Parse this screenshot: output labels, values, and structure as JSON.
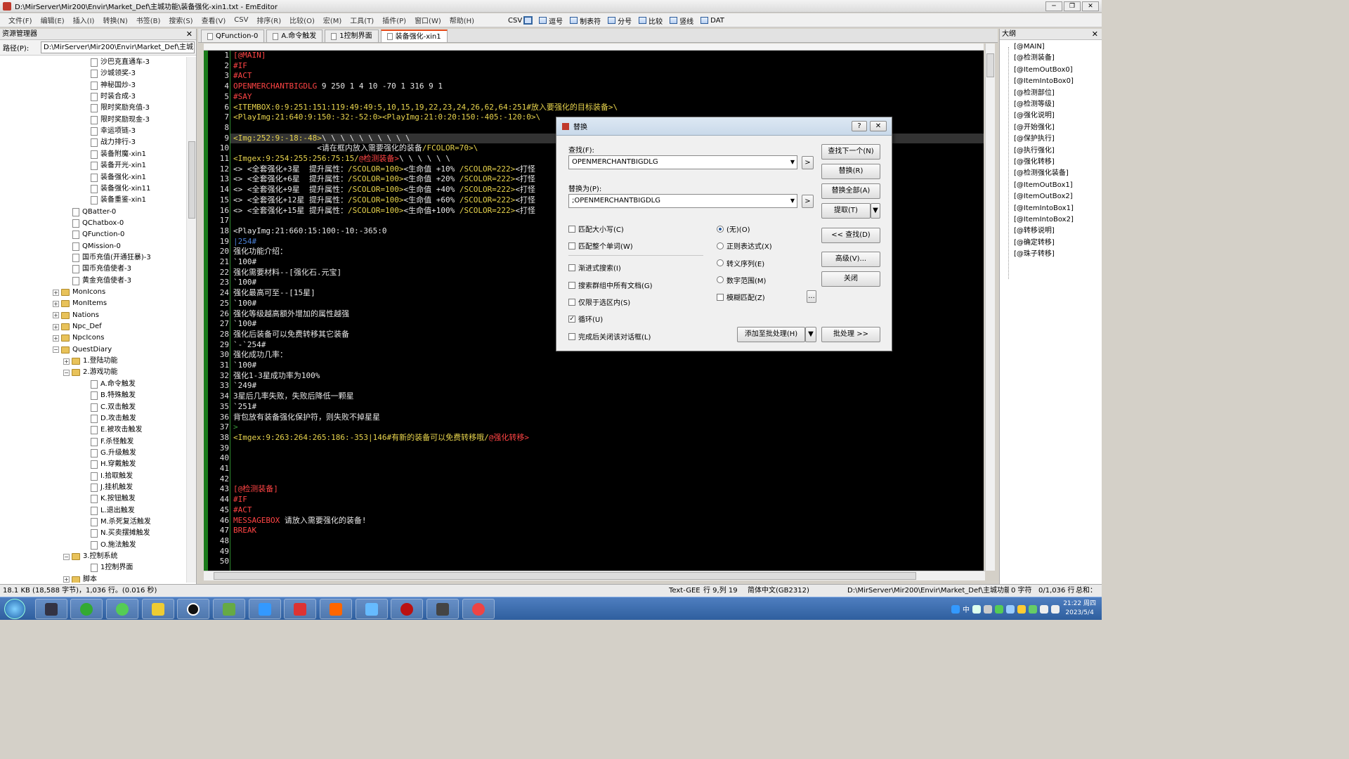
{
  "window": {
    "title": "D:\\MirServer\\Mir200\\Envir\\Market_Def\\主城功能\\装备强化-xin1.txt - EmEditor",
    "min": "─",
    "max": "❐",
    "close": "✕"
  },
  "menu": [
    "文件(F)",
    "编辑(E)",
    "插入(I)",
    "转换(N)",
    "书签(B)",
    "搜索(S)",
    "查看(V)",
    "CSV",
    "排序(R)",
    "比较(O)",
    "宏(M)",
    "工具(T)",
    "插件(P)",
    "窗口(W)",
    "帮助(H)"
  ],
  "toolbar": {
    "csv": "CSV",
    "items": [
      "逗号",
      "制表符",
      "分号",
      "比较",
      "竖线",
      "DAT"
    ]
  },
  "explorer": {
    "title": "资源管理器",
    "close": "✕",
    "path_label": "路径(P):",
    "path": "D:\\MirServer\\Mir200\\Envir\\Market_Def\\主城"
  },
  "tree": [
    {
      "l": "沙巴克直通车-3",
      "d": 3,
      "t": "doc"
    },
    {
      "l": "沙城领奖-3",
      "d": 3,
      "t": "doc"
    },
    {
      "l": "神秘国炒-3",
      "d": 3,
      "t": "doc"
    },
    {
      "l": "时装合成-3",
      "d": 3,
      "t": "doc"
    },
    {
      "l": "限时奖励充值-3",
      "d": 3,
      "t": "doc"
    },
    {
      "l": "限时奖励现金-3",
      "d": 3,
      "t": "doc"
    },
    {
      "l": "幸运项链-3",
      "d": 3,
      "t": "doc"
    },
    {
      "l": "战力排行-3",
      "d": 3,
      "t": "doc"
    },
    {
      "l": "装备附魔-xin1",
      "d": 3,
      "t": "doc"
    },
    {
      "l": "装备开光-xin1",
      "d": 3,
      "t": "doc"
    },
    {
      "l": "装备强化-xin1",
      "d": 3,
      "t": "doc"
    },
    {
      "l": "装备强化-xin11",
      "d": 3,
      "t": "doc"
    },
    {
      "l": "装备重鉴-xin1",
      "d": 3,
      "t": "doc"
    },
    {
      "l": "QBatter-0",
      "d": 2,
      "t": "doc"
    },
    {
      "l": "QChatbox-0",
      "d": 2,
      "t": "doc"
    },
    {
      "l": "QFunction-0",
      "d": 2,
      "t": "doc"
    },
    {
      "l": "QMission-0",
      "d": 2,
      "t": "doc"
    },
    {
      "l": "国币充值(开通狂暴)-3",
      "d": 2,
      "t": "doc"
    },
    {
      "l": "国币充值使者-3",
      "d": 2,
      "t": "doc"
    },
    {
      "l": "黄金充值使者-3",
      "d": 2,
      "t": "doc"
    },
    {
      "l": "MonIcons",
      "d": 1,
      "t": "fold",
      "e": "+"
    },
    {
      "l": "MonItems",
      "d": 1,
      "t": "fold",
      "e": "+"
    },
    {
      "l": "Nations",
      "d": 1,
      "t": "fold",
      "e": "+"
    },
    {
      "l": "Npc_Def",
      "d": 1,
      "t": "fold",
      "e": "+"
    },
    {
      "l": "NpcIcons",
      "d": 1,
      "t": "fold",
      "e": "+"
    },
    {
      "l": "QuestDiary",
      "d": 1,
      "t": "fold",
      "e": "−"
    },
    {
      "l": "1.登陆功能",
      "d": 2,
      "t": "fold",
      "e": "+"
    },
    {
      "l": "2.游戏功能",
      "d": 2,
      "t": "fold",
      "e": "−"
    },
    {
      "l": "A.命令触发",
      "d": 3,
      "t": "doc"
    },
    {
      "l": "B.特殊触发",
      "d": 3,
      "t": "doc"
    },
    {
      "l": "C.双击触发",
      "d": 3,
      "t": "doc"
    },
    {
      "l": "D.攻击触发",
      "d": 3,
      "t": "doc"
    },
    {
      "l": "E.被攻击触发",
      "d": 3,
      "t": "doc"
    },
    {
      "l": "F.杀怪触发",
      "d": 3,
      "t": "doc"
    },
    {
      "l": "G.升级触发",
      "d": 3,
      "t": "doc"
    },
    {
      "l": "H.穿戴触发",
      "d": 3,
      "t": "doc"
    },
    {
      "l": "I.拾取触发",
      "d": 3,
      "t": "doc"
    },
    {
      "l": "J.挂机触发",
      "d": 3,
      "t": "doc"
    },
    {
      "l": "K.按钮触发",
      "d": 3,
      "t": "doc"
    },
    {
      "l": "L.退出触发",
      "d": 3,
      "t": "doc"
    },
    {
      "l": "M.杀死复活触发",
      "d": 3,
      "t": "doc"
    },
    {
      "l": "N.买卖摆摊触发",
      "d": 3,
      "t": "doc"
    },
    {
      "l": "O.施法触发",
      "d": 3,
      "t": "doc"
    },
    {
      "l": "3.控制系统",
      "d": 2,
      "t": "fold",
      "e": "−"
    },
    {
      "l": "1控制界面",
      "d": 3,
      "t": "doc"
    },
    {
      "l": "脚本",
      "d": 2,
      "t": "fold",
      "e": "+"
    }
  ],
  "tabs": [
    "QFunction-0",
    "A.命令触发",
    "1控制界面",
    "装备强化-xin1"
  ],
  "active_tab": 3,
  "lines": [
    [
      [
        "[@MAIN]",
        "#ff4444"
      ]
    ],
    [
      [
        "#IF",
        "#ff4444"
      ]
    ],
    [
      [
        "#ACT",
        "#ff4444"
      ]
    ],
    [
      [
        "OPENMERCHANTBIGDLG",
        "#ff4444"
      ],
      [
        " 9 250 1 4 10 -70 1 316 9 1",
        "#e8e8e8"
      ]
    ],
    [
      [
        "#SAY",
        "#ff4444"
      ]
    ],
    [
      [
        "<ITEMBOX:0:9:251:151:119:49:49:5,10,15,19,22,23,24,26,62,64:251#放入要强化的目标装备>\\",
        "#e8d44d"
      ]
    ],
    [
      [
        "<PlayImg:21:640:9:150:-32:-52:0>",
        "#e8d44d"
      ],
      [
        "<PlayImg:21:0:20:150:-405:-120:0>\\",
        "#e8d44d"
      ]
    ],
    [
      [
        "",
        "#e8e8e8"
      ]
    ],
    [
      [
        "<Img:252:9:-18:-48>",
        "#e8d44d"
      ],
      [
        "\\ \\ \\ \\ \\ \\ \\ \\ \\ \\",
        "#e8e8e8"
      ]
    ],
    [
      [
        "                  <请在框内放入需要强化的装备",
        "#e8e8e8"
      ],
      [
        "/FCOLOR=70>\\",
        "#e8d44d"
      ]
    ],
    [
      [
        "<Imgex:9:254:255:256:75:15/",
        "#e8d44d"
      ],
      [
        "@检测装备>",
        "#ff4444"
      ],
      [
        "\\ \\ \\ \\ \\ \\",
        "#e8e8e8"
      ]
    ],
    [
      [
        "<> <全套强化+3星  提升属性：",
        "#e8e8e8"
      ],
      [
        "/SCOLOR=100>",
        "#e8d44d"
      ],
      [
        "<生命值 +10% ",
        "#e8e8e8"
      ],
      [
        "/SCOLOR=222>",
        "#e8d44d"
      ],
      [
        "<打怪",
        "#e8e8e8"
      ]
    ],
    [
      [
        "<> <全套强化+6星  提升属性：",
        "#e8e8e8"
      ],
      [
        "/SCOLOR=100>",
        "#e8d44d"
      ],
      [
        "<生命值 +20% ",
        "#e8e8e8"
      ],
      [
        "/SCOLOR=222>",
        "#e8d44d"
      ],
      [
        "<打怪",
        "#e8e8e8"
      ]
    ],
    [
      [
        "<> <全套强化+9星  提升属性：",
        "#e8e8e8"
      ],
      [
        "/SCOLOR=100>",
        "#e8d44d"
      ],
      [
        "<生命值 +40% ",
        "#e8e8e8"
      ],
      [
        "/SCOLOR=222>",
        "#e8d44d"
      ],
      [
        "<打怪",
        "#e8e8e8"
      ]
    ],
    [
      [
        "<> <全套强化+12星 提升属性：",
        "#e8e8e8"
      ],
      [
        "/SCOLOR=100>",
        "#e8d44d"
      ],
      [
        "<生命值 +60% ",
        "#e8e8e8"
      ],
      [
        "/SCOLOR=222>",
        "#e8d44d"
      ],
      [
        "<打怪",
        "#e8e8e8"
      ]
    ],
    [
      [
        "<> <全套强化+15星 提升属性：",
        "#e8e8e8"
      ],
      [
        "/SCOLOR=100>",
        "#e8d44d"
      ],
      [
        "<生命值+100% ",
        "#e8e8e8"
      ],
      [
        "/SCOLOR=222>",
        "#e8d44d"
      ],
      [
        "<打怪",
        "#e8e8e8"
      ]
    ],
    [
      [
        "",
        "#e8e8e8"
      ]
    ],
    [
      [
        "<PlayImg:21:660:15:100:-10:-365:0",
        "#e8e8e8"
      ]
    ],
    [
      [
        "|254#",
        "#4a7fd4"
      ]
    ],
    [
      [
        "强化功能介绍：",
        "#e8e8e8"
      ]
    ],
    [
      [
        "`100#",
        "#e8e8e8"
      ]
    ],
    [
      [
        "强化需要材料--[强化石.元宝]",
        "#e8e8e8"
      ]
    ],
    [
      [
        "`100#",
        "#e8e8e8"
      ]
    ],
    [
      [
        "强化最高可至--[15星]",
        "#e8e8e8"
      ]
    ],
    [
      [
        "`100#",
        "#e8e8e8"
      ]
    ],
    [
      [
        "强化等级越高额外增加的属性越强",
        "#e8e8e8"
      ]
    ],
    [
      [
        "`100#",
        "#e8e8e8"
      ]
    ],
    [
      [
        "强化后装备可以免费转移其它装备",
        "#e8e8e8"
      ]
    ],
    [
      [
        "`-`254#",
        "#e8e8e8"
      ]
    ],
    [
      [
        "强化成功几率：",
        "#e8e8e8"
      ]
    ],
    [
      [
        "`100#",
        "#e8e8e8"
      ]
    ],
    [
      [
        "强化1-3星成功率为100%",
        "#e8e8e8"
      ]
    ],
    [
      [
        "`249#",
        "#e8e8e8"
      ]
    ],
    [
      [
        "3星后几率失败，失败后降低一颗星",
        "#e8e8e8"
      ]
    ],
    [
      [
        "`251#",
        "#e8e8e8"
      ]
    ],
    [
      [
        "背包放有装备强化保护符，则失败不掉星星",
        "#e8e8e8"
      ]
    ],
    [
      [
        ">",
        "#3a9a3a"
      ]
    ],
    [
      [
        "<Imgex:9:263:264:265:186:-353|146#有新的装备可以免费转移哦/",
        "#e8d44d"
      ],
      [
        "@强化转移>",
        "#ff4444"
      ]
    ],
    [
      [
        "",
        "#e8e8e8"
      ]
    ],
    [
      [
        "",
        "#e8e8e8"
      ]
    ],
    [
      [
        "",
        "#e8e8e8"
      ]
    ],
    [
      [
        "",
        "#e8e8e8"
      ]
    ],
    [
      [
        "[@检测装备]",
        "#ff4444"
      ]
    ],
    [
      [
        "#IF",
        "#ff4444"
      ]
    ],
    [
      [
        "#ACT",
        "#ff4444"
      ]
    ],
    [
      [
        "MESSAGEBOX",
        "#ff4444"
      ],
      [
        " 请放入需要强化的装备!",
        "#e8e8e8"
      ]
    ],
    [
      [
        "BREAK",
        "#ff4444"
      ]
    ],
    [
      [
        "",
        "#e8e8e8"
      ]
    ],
    [
      [
        "",
        "#e8e8e8"
      ]
    ],
    [
      [
        "",
        "#e8e8e8"
      ]
    ]
  ],
  "outline": {
    "title": "大纲",
    "close": "✕",
    "items": [
      "[@MAIN]",
      "[@检测装备]",
      "[@ItemOutBox0]",
      "[@ItemIntoBox0]",
      "[@检测部位]",
      "[@检测等级]",
      "[@强化说明]",
      "[@开始强化]",
      "[@保护执行]",
      "[@执行强化]",
      "[@强化转移]",
      "[@检测强化装备]",
      "[@ItemOutBox1]",
      "[@ItemOutBox2]",
      "[@ItemIntoBox1]",
      "[@ItemIntoBox2]",
      "[@转移说明]",
      "[@确定转移]",
      "[@珠子转移]"
    ]
  },
  "dialog": {
    "title": "替换",
    "help": "?",
    "close": "✕",
    "find_label": "查找(F):",
    "find_value": "OPENMERCHANTBIGDLG",
    "replace_label": "替换为(P):",
    "replace_value": ";OPENMERCHANTBIGDLG",
    "arrow": ">",
    "dd": "▼",
    "buttons": {
      "find_next": "查找下一个(N)",
      "replace": "替换(R)",
      "replace_all": "替换全部(A)",
      "extract": "提取(T)",
      "find_prev": "<< 查找(D)",
      "advanced": "高级(V)...",
      "close": "关闭",
      "add_batch": "添加至批处理(H)",
      "batch": "批处理 >>",
      "more": "..."
    },
    "checks": [
      {
        "l": "匹配大小写(C)",
        "on": false
      },
      {
        "l": "匹配整个单词(W)",
        "on": false
      },
      {
        "l": "渐进式搜索(I)",
        "on": false
      },
      {
        "l": "搜索群组中所有文档(G)",
        "on": false
      },
      {
        "l": "仅限于选区内(S)",
        "on": false
      },
      {
        "l": "循环(U)",
        "on": true
      },
      {
        "l": "完成后关闭该对话框(L)",
        "on": false
      }
    ],
    "radios": [
      {
        "l": "(无)(O)",
        "on": true
      },
      {
        "l": "正则表达式(X)",
        "on": false
      },
      {
        "l": "转义序列(E)",
        "on": false
      },
      {
        "l": "数字范围(M)",
        "on": false
      }
    ],
    "fuzzy": "模糊匹配(Z)",
    "check_mark": "✓"
  },
  "status": {
    "size": "18.1 KB (18,588 字节)，1,036 行。(0.016 秒)",
    "mode": "Text-GEE",
    "pos": "行 9,列 19",
    "enc": "简体中文(GB2312)",
    "path": "D:\\MirServer\\Mir200\\Envir\\Market_Def\\主城功能",
    "chars": "0 字符",
    "lines": "0/1,036 行",
    "total": "总和："
  },
  "taskbar": {
    "ime": "中",
    "time": "21:22 周四",
    "date": "2023/5/4"
  },
  "colors": {
    "gutter_border": "#2e8b2e",
    "current_line": "#333333",
    "accent_tab": "#e64a19"
  }
}
